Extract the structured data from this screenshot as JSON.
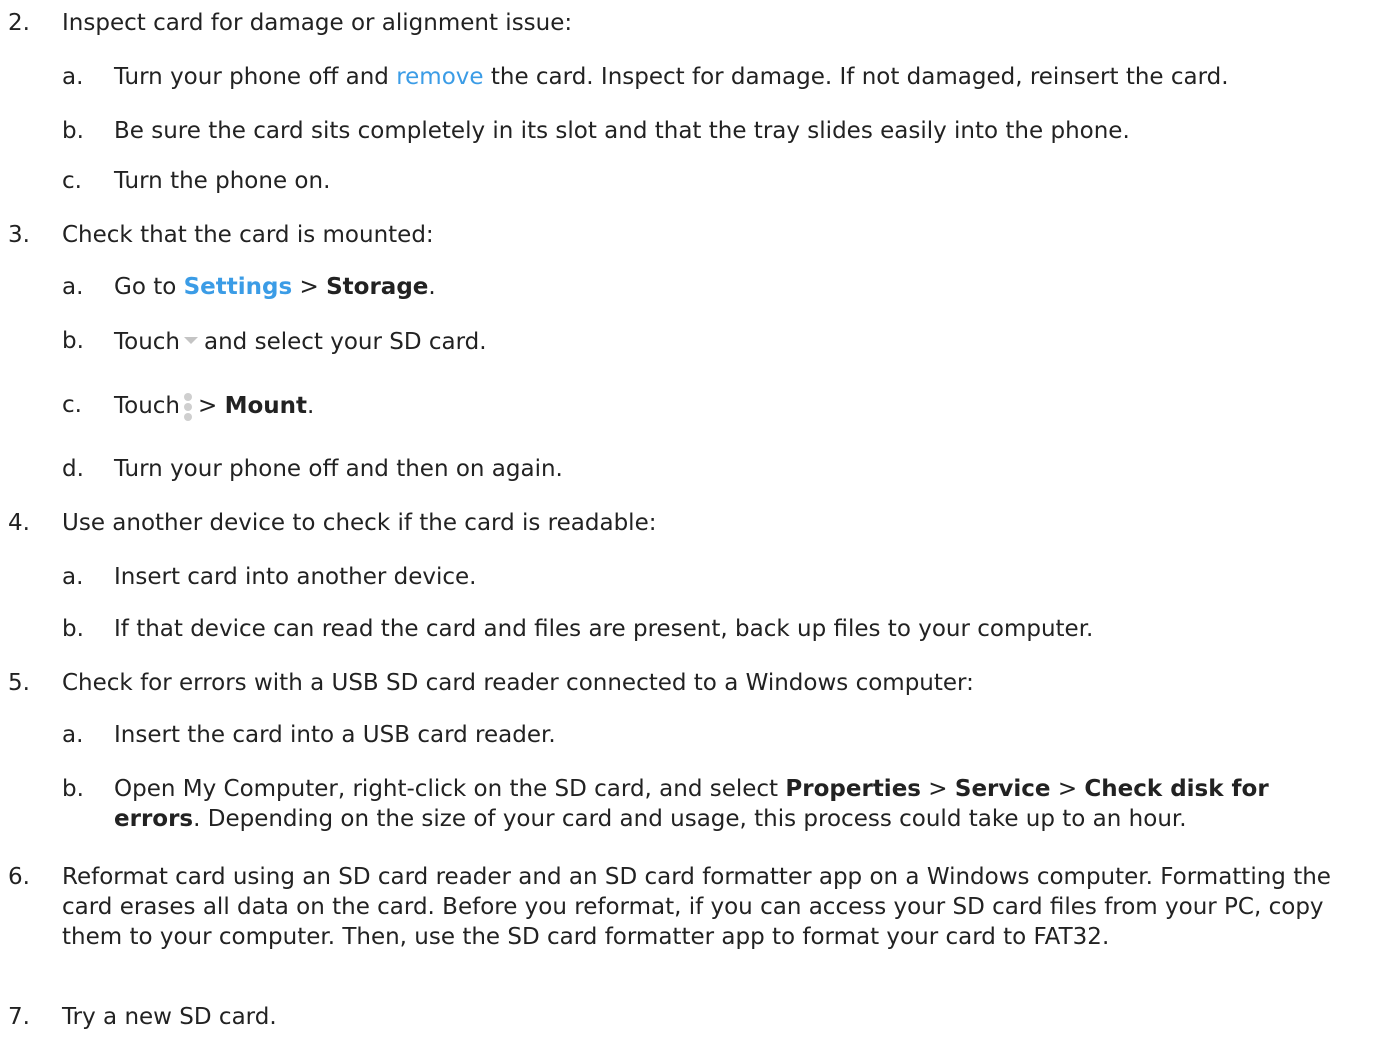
{
  "steps": [
    {
      "num": "2.",
      "text": "Inspect card for damage or alignment issue:",
      "sub": [
        {
          "letter": "a.",
          "pre": "Turn your phone off and ",
          "link": "remove",
          "post": " the card. Inspect for damage. If not damaged, reinsert the card."
        },
        {
          "letter": "b.",
          "text": "Be sure the card sits completely in its slot and that the tray slides easily into the phone."
        },
        {
          "letter": "c.",
          "text": "Turn the phone on."
        }
      ]
    },
    {
      "num": "3.",
      "text": "Check that the card is mounted:",
      "sub": [
        {
          "letter": "a.",
          "pre": "Go to ",
          "settings": "Settings",
          "sep": " > ",
          "storage": "Storage",
          "post": "."
        },
        {
          "letter": "b.",
          "pre": "Touch",
          "post": "and select your SD card.",
          "icon": "dropdown-triangle-icon"
        },
        {
          "letter": "c.",
          "pre": "Touch",
          "sep": "> ",
          "mount": "Mount",
          "post": ".",
          "icon": "overflow-menu-icon"
        },
        {
          "letter": "d.",
          "text": "Turn your phone off and then on again."
        }
      ]
    },
    {
      "num": "4.",
      "text": "Use another device to check if the card is readable:",
      "sub": [
        {
          "letter": "a.",
          "text": "Insert card into another device."
        },
        {
          "letter": "b.",
          "text": "If that device can read the card and files are present, back up files to your computer."
        }
      ]
    },
    {
      "num": "5.",
      "text": "Check for errors with a USB SD card reader connected to a Windows computer:",
      "sub": [
        {
          "letter": "a.",
          "text": "Insert the card into a USB card reader."
        },
        {
          "letter": "b.",
          "pre": "Open My Computer, right-click on the SD card, and select ",
          "b1": "Properties",
          "s1": " > ",
          "b2": "Service",
          "s2": " > ",
          "b3": "Check disk for errors",
          "post": ". Depending on the size of your card and usage, this process could take up to an hour."
        }
      ]
    },
    {
      "num": "6.",
      "text": "Reformat card using an SD card reader and an SD card formatter app on a Windows computer. Formatting the card erases all data on the card. Before you reformat, if you can access your SD card files from your PC, copy them to your computer. Then, use the SD card formatter app to format your card to FAT32."
    },
    {
      "num": "7.",
      "text": "Try a new SD card."
    }
  ],
  "colors": {
    "text": "#222222",
    "link": "#3b9ce6",
    "icon": "#c4c4c4"
  }
}
